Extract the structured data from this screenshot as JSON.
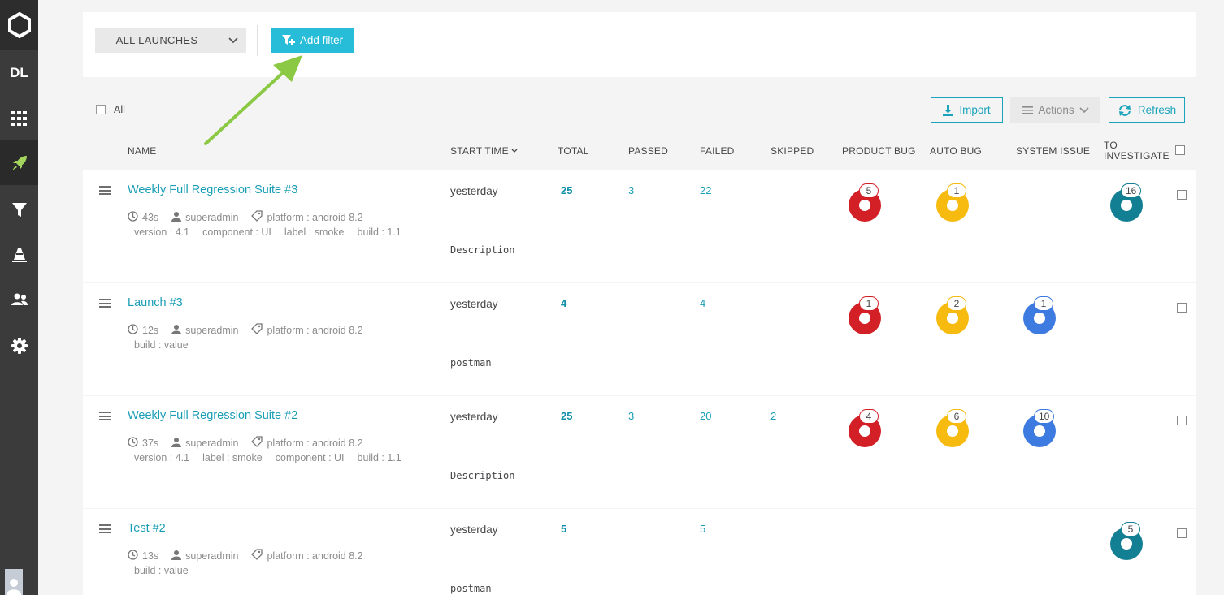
{
  "sidebar": {
    "project_tag": "DL",
    "items": [
      {
        "icon": "dashboard-grid-icon"
      },
      {
        "icon": "launches-rocket-icon",
        "active": true
      },
      {
        "icon": "filters-funnel-icon"
      },
      {
        "icon": "debug-cone-icon"
      },
      {
        "icon": "members-icon"
      },
      {
        "icon": "settings-gear-icon"
      }
    ]
  },
  "filter_bar": {
    "launch_select": "ALL LAUNCHES",
    "add_filter": "Add filter"
  },
  "toolbar": {
    "all_label": "All",
    "import": "Import",
    "actions": "Actions",
    "refresh": "Refresh"
  },
  "columns": {
    "name": "NAME",
    "start_time": "START TIME",
    "total": "TOTAL",
    "passed": "PASSED",
    "failed": "FAILED",
    "skipped": "SKIPPED",
    "product_bug": "PRODUCT BUG",
    "auto_bug": "AUTO BUG",
    "system_issue": "SYSTEM ISSUE",
    "to_investigate_1": "TO",
    "to_investigate_2": "INVESTIGATE"
  },
  "colors": {
    "accent": "#27bcd8",
    "product_bug": "#d32027",
    "auto_bug": "#f7bb10",
    "system_issue": "#3e7be0",
    "to_investigate": "#137f93"
  },
  "launches": [
    {
      "name": "Weekly Full Regression Suite #3",
      "duration": "43s",
      "owner": "superadmin",
      "platform": "platform : android 8.2",
      "attrs": [
        "version : 4.1",
        "component : UI",
        "label : smoke",
        "build : 1.1"
      ],
      "start": "yesterday",
      "description": "Description",
      "total": "25",
      "passed": "3",
      "failed": "22",
      "skipped": "",
      "product_bug": "5",
      "auto_bug": "1",
      "system_issue": "",
      "to_investigate": "16"
    },
    {
      "name": "Launch #3",
      "duration": "12s",
      "owner": "superadmin",
      "platform": "platform : android 8.2",
      "attrs": [
        "build : value"
      ],
      "start": "yesterday",
      "description": "postman",
      "total": "4",
      "passed": "",
      "failed": "4",
      "skipped": "",
      "product_bug": "1",
      "auto_bug": "2",
      "system_issue": "1",
      "to_investigate": ""
    },
    {
      "name": "Weekly Full Regression Suite #2",
      "duration": "37s",
      "owner": "superadmin",
      "platform": "platform : android 8.2",
      "attrs": [
        "version : 4.1",
        "label : smoke",
        "component : UI",
        "build : 1.1"
      ],
      "start": "yesterday",
      "description": "Description",
      "total": "25",
      "passed": "3",
      "failed": "20",
      "skipped": "2",
      "product_bug": "4",
      "auto_bug": "6",
      "system_issue": "10",
      "to_investigate": ""
    },
    {
      "name": "Test #2",
      "duration": "13s",
      "owner": "superadmin",
      "platform": "platform : android 8.2",
      "attrs": [
        "build : value"
      ],
      "start": "yesterday",
      "description": "postman",
      "total": "5",
      "passed": "",
      "failed": "5",
      "skipped": "",
      "product_bug": "",
      "auto_bug": "",
      "system_issue": "",
      "to_investigate": "5"
    }
  ]
}
